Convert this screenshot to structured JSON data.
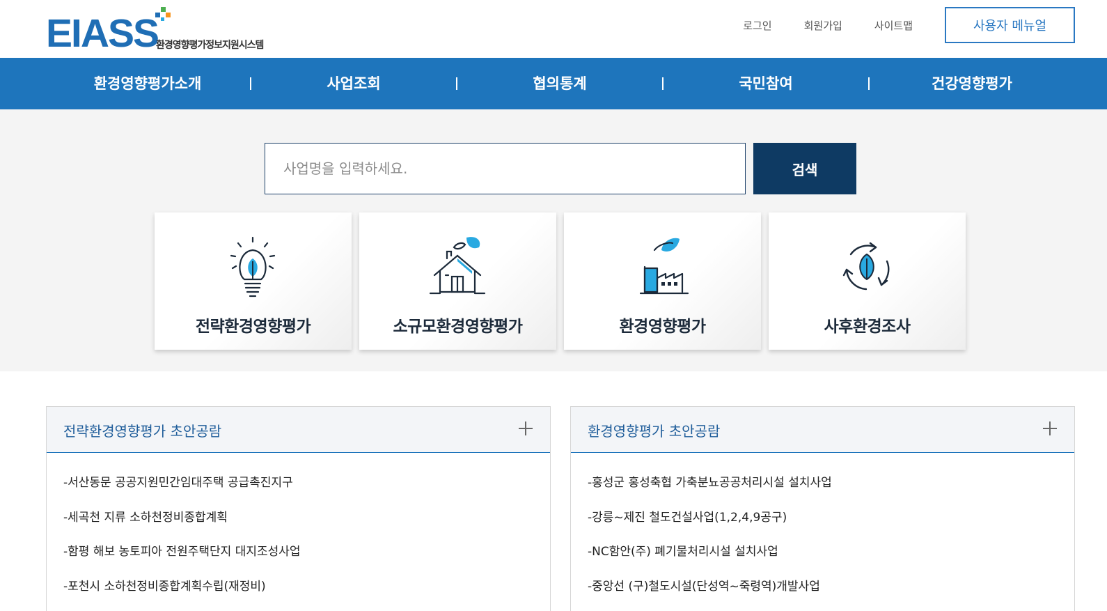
{
  "header": {
    "logo_text": "EIASS",
    "logo_subtitle": "환경영향평가정보지원시스템",
    "links": [
      "로그인",
      "회원가입",
      "사이트맵"
    ],
    "manual_button": "사용자 메뉴얼"
  },
  "nav": {
    "items": [
      "환경영향평가소개",
      "사업조회",
      "협의통계",
      "국민참여",
      "건강영향평가"
    ]
  },
  "search": {
    "placeholder": "사업명을 입력하세요.",
    "button_label": "검색"
  },
  "cards": [
    {
      "label": "전략환경영향평가",
      "icon": "lightbulb-leaf-icon"
    },
    {
      "label": "소규모환경영향평가",
      "icon": "house-leaf-icon"
    },
    {
      "label": "환경영향평가",
      "icon": "factory-leaf-icon"
    },
    {
      "label": "사후환경조사",
      "icon": "recycle-leaf-icon"
    }
  ],
  "panels": [
    {
      "title": "전략환경영향평가 초안공람",
      "items": [
        "-서산동문 공공지원민간임대주택 공급촉진지구",
        "-세곡천 지류 소하천정비종합계획",
        "-함평 해보 농토피아 전원주택단지 대지조성사업",
        "-포천시 소하천정비종합계획수립(재정비)"
      ]
    },
    {
      "title": "환경영향평가 초안공람",
      "items": [
        "-홍성군 홍성축협 가축분뇨공공처리시설 설치사업",
        "-강릉~제진 철도건설사업(1,2,4,9공구)",
        "-NC함안(주) 폐기물처리시설 설치사업",
        "-중앙선 (구)철도시설(단성역~죽령역)개발사업"
      ]
    }
  ],
  "colors": {
    "brand_blue": "#1e75bc",
    "navy": "#0e3a63",
    "accent_cyan": "#29a9e1",
    "logo_green": "#4caf50",
    "logo_orange": "#f7941d"
  }
}
